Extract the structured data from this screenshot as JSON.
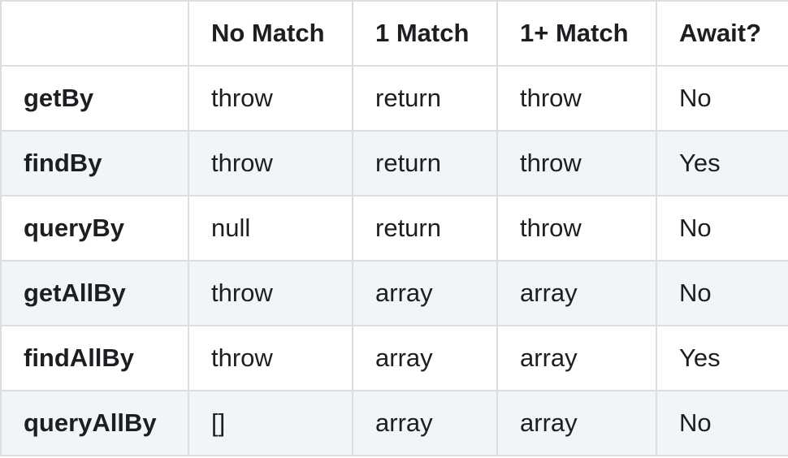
{
  "table": {
    "headers": [
      "",
      "No Match",
      "1 Match",
      "1+ Match",
      "Await?"
    ],
    "rows": [
      {
        "label": "getBy",
        "cells": [
          "throw",
          "return",
          "throw",
          "No"
        ]
      },
      {
        "label": "findBy",
        "cells": [
          "throw",
          "return",
          "throw",
          "Yes"
        ]
      },
      {
        "label": "queryBy",
        "cells": [
          "null",
          "return",
          "throw",
          "No"
        ]
      },
      {
        "label": "getAllBy",
        "cells": [
          "throw",
          "array",
          "array",
          "No"
        ]
      },
      {
        "label": "findAllBy",
        "cells": [
          "throw",
          "array",
          "array",
          "Yes"
        ]
      },
      {
        "label": "queryAllBy",
        "cells": [
          "[]",
          "array",
          "array",
          "No"
        ]
      }
    ]
  }
}
